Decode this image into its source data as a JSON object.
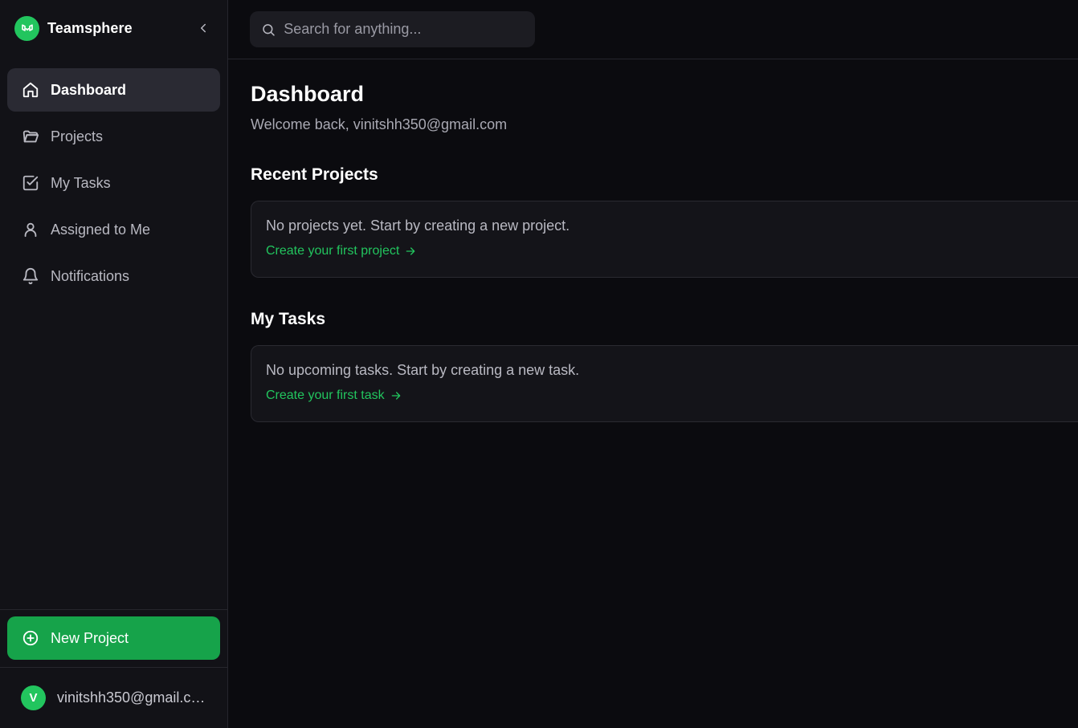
{
  "brand": {
    "name": "Teamsphere",
    "color": "#22c55e"
  },
  "sidebar": {
    "items": [
      {
        "label": "Dashboard",
        "icon": "home-icon",
        "active": true
      },
      {
        "label": "Projects",
        "icon": "folder-icon",
        "active": false
      },
      {
        "label": "My Tasks",
        "icon": "check-square-icon",
        "active": false
      },
      {
        "label": "Assigned to Me",
        "icon": "user-icon",
        "active": false
      },
      {
        "label": "Notifications",
        "icon": "bell-icon",
        "active": false
      }
    ],
    "new_project_label": "New Project",
    "user": {
      "initial": "V",
      "email": "vinitshh350@gmail.co..."
    }
  },
  "search": {
    "placeholder": "Search for anything..."
  },
  "main": {
    "title": "Dashboard",
    "welcome": "Welcome back, vinitshh350@gmail.com",
    "recent_projects": {
      "title": "Recent Projects",
      "empty_text": "No projects yet. Start by creating a new project.",
      "link": "Create your first project"
    },
    "my_tasks": {
      "title": "My Tasks",
      "empty_text": "No upcoming tasks. Start by creating a new task.",
      "link": "Create your first task"
    }
  },
  "colors": {
    "accent": "#22c55e",
    "button": "#16a34a",
    "background": "#0b0b0f",
    "sidebar": "#121217"
  }
}
